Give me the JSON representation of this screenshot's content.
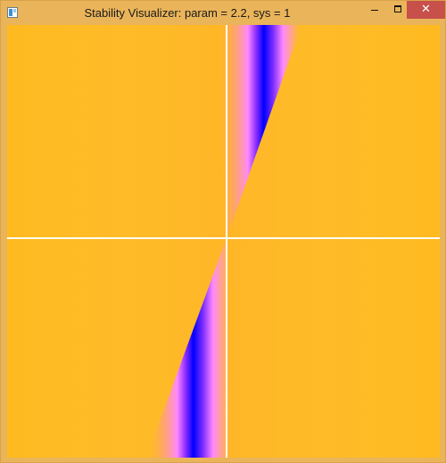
{
  "window": {
    "title": "Stability Visualizer: param = 2.2, sys = 1",
    "controls": {
      "minimize_icon": "minimize-icon",
      "maximize_icon": "maximize-icon",
      "close_icon": "close-icon",
      "close_glyph": "✕"
    },
    "frame_color": "#eab45a",
    "close_color": "#c7504b"
  },
  "visualization": {
    "background_color": "#ffba1f",
    "axes_color": "#ffffff",
    "stability_colors": [
      "#ffba1f",
      "#ff9090",
      "#ff88ff",
      "#9b30ff",
      "#0000ff"
    ],
    "band_orientation": "bottom-left to top-right"
  }
}
